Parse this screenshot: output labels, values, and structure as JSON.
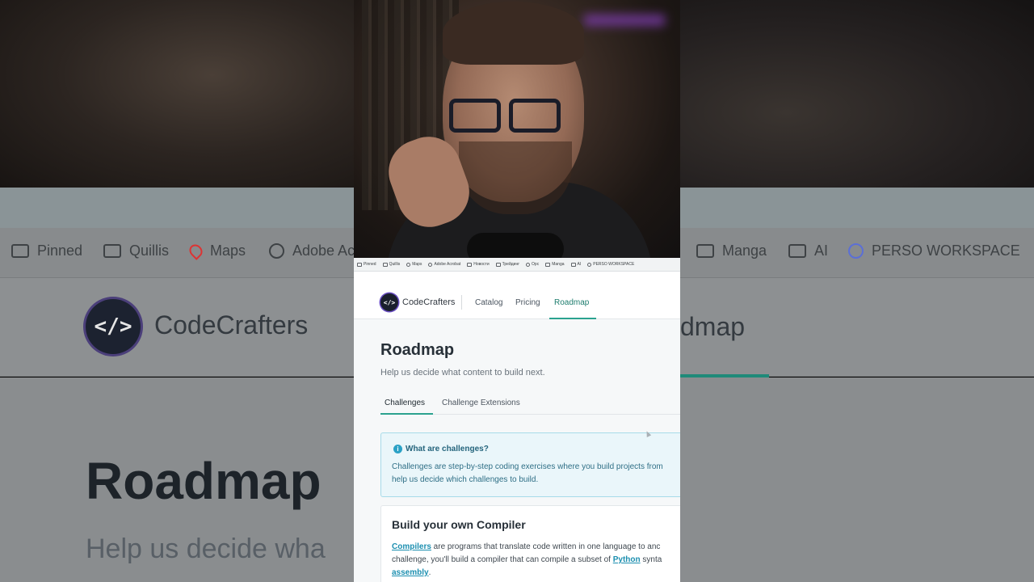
{
  "bookmarks": [
    {
      "label": "Pinned",
      "icon": "folder-icon"
    },
    {
      "label": "Quillis",
      "icon": "folder-icon"
    },
    {
      "label": "Maps",
      "icon": "maps-pin-icon"
    },
    {
      "label": "Adobe Acrobat",
      "icon": "globe-icon"
    },
    {
      "label": "Новости",
      "icon": "folder-icon"
    },
    {
      "label": "Трейдинг",
      "icon": "folder-icon"
    },
    {
      "label": "Opc",
      "icon": "globe-icon"
    },
    {
      "label": "Manga",
      "icon": "folder-icon"
    },
    {
      "label": "AI",
      "icon": "folder-icon"
    },
    {
      "label": "PERSO WORKSPACE",
      "icon": "circle-icon"
    }
  ],
  "background_bookmarks_left": [
    "Pinned",
    "Quillis",
    "Maps",
    "Adobe Ac"
  ],
  "background_bookmarks_right": [
    "Manga",
    "AI",
    "PERSO WORKSPACE"
  ],
  "background": {
    "brand": "CodeCrafters",
    "title": "Roadmap",
    "subtitle": "Help us decide wha",
    "nav_fragment": "dmap"
  },
  "navbar": {
    "logo_glyph": "</>",
    "brand": "CodeCrafters",
    "links": [
      "Catalog",
      "Pricing",
      "Roadmap"
    ],
    "active": "Roadmap"
  },
  "page": {
    "title": "Roadmap",
    "subtitle": "Help us decide what content to build next."
  },
  "tabs": {
    "items": [
      "Challenges",
      "Challenge Extensions"
    ],
    "active": "Challenges"
  },
  "info": {
    "icon_glyph": "i",
    "title": "What are challenges?",
    "line1": "Challenges are step-by-step coding exercises where you build projects from",
    "line2": "help us decide which challenges to build."
  },
  "card": {
    "title": "Build your own Compiler",
    "link_compilers": "Compilers",
    "text1": " are programs that translate code written in one language to anc",
    "text2a": "challenge, you'll build a compiler that can compile a subset of ",
    "link_python": "Python",
    "text2b": " synta",
    "link_assembly": "assembly",
    "text3": "."
  },
  "colors": {
    "accent": "#2ba28f",
    "info_bg": "#eaf6fa",
    "info_border": "#a7dbe9",
    "link": "#1c8fb0"
  }
}
